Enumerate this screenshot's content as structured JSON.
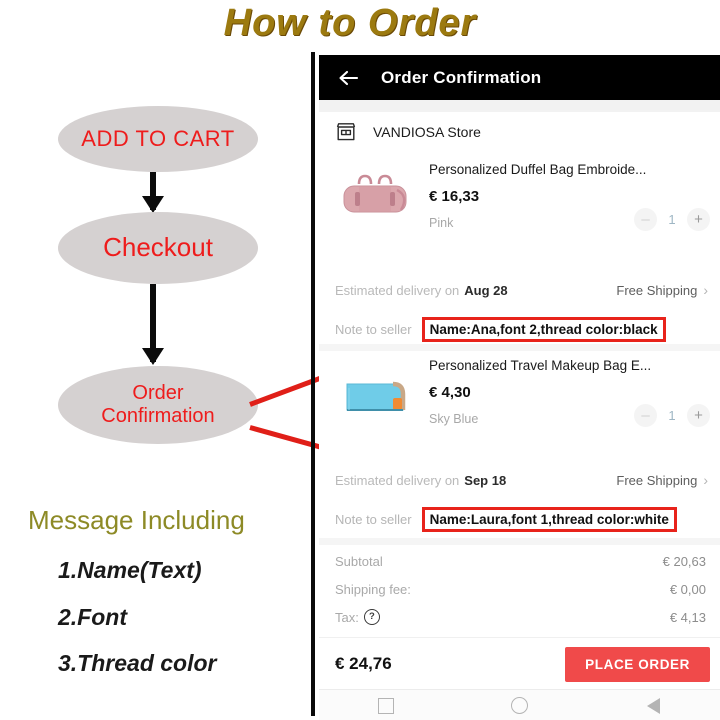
{
  "infographic": {
    "title": "How  to  Order",
    "title_color": "#9c7a10",
    "steps": [
      {
        "label": "ADD TO CART"
      },
      {
        "label": "Checkout"
      },
      {
        "label": "Order\nConfirmation"
      }
    ],
    "step_text_color": "#ee1c1c",
    "step_fill_color": "#d5d1d1",
    "message_heading": "Message Including",
    "message_items": [
      {
        "label": "1.Name(Text)"
      },
      {
        "label": "2.Font"
      },
      {
        "label": "3.Thread color"
      }
    ],
    "annotation_color": "#e01f18"
  },
  "phone": {
    "appbar": {
      "back_icon": "back-arrow-icon",
      "title": "Order Confirmation"
    },
    "store": {
      "icon": "storefront-icon",
      "name": "VANDIOSA Store"
    },
    "items": [
      {
        "image": "pink-duffel-bag",
        "title": "Personalized Duffel Bag Embroide...",
        "price": "€ 16,33",
        "variant": "Pink",
        "minus": "–",
        "qty": "1",
        "plus": "+",
        "delivery_label": "Estimated delivery on",
        "delivery_date": "Aug 28",
        "shipping": "Free Shipping",
        "chevron": "›",
        "note_label": "Note to seller",
        "note_value": "Name:Ana,font 2,thread color:black"
      },
      {
        "image": "sky-blue-makeup-bag",
        "title": "Personalized Travel Makeup Bag E...",
        "price": "€ 4,30",
        "variant": "Sky Blue",
        "minus": "–",
        "qty": "1",
        "plus": "+",
        "delivery_label": "Estimated delivery on",
        "delivery_date": "Sep 18",
        "shipping": "Free Shipping",
        "chevron": "›",
        "note_label": "Note to seller",
        "note_value": "Name:Laura,font 1,thread color:white"
      }
    ],
    "totals": [
      {
        "label": "Subtotal",
        "value": "€ 20,63",
        "help": false
      },
      {
        "label": "Shipping fee:",
        "value": "€ 0,00",
        "help": false
      },
      {
        "label": "Tax:",
        "value": "€ 4,13",
        "help": true,
        "help_glyph": "?"
      }
    ],
    "bottom": {
      "grand_total": "€ 24,76",
      "place_order_label": "PLACE ORDER",
      "place_order_color": "#f04a4a"
    },
    "navbar": {
      "recents": "square-icon",
      "home": "circle-icon",
      "back": "triangle-back-icon"
    }
  }
}
